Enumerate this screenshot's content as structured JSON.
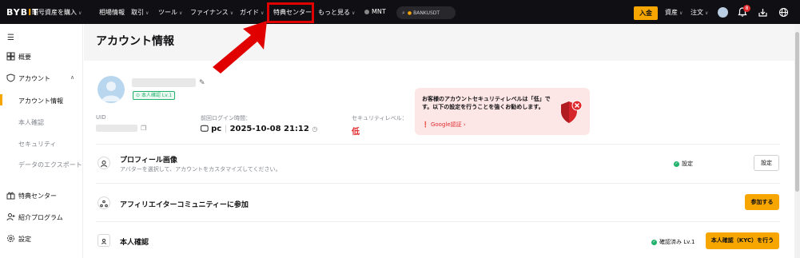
{
  "topnav": {
    "logo": "BYBIT",
    "items": [
      {
        "label": "暗号資産を購入",
        "caret": true
      },
      {
        "label": "相場情報",
        "caret": false
      },
      {
        "label": "取引",
        "caret": true
      },
      {
        "label": "ツール",
        "caret": true
      },
      {
        "label": "ファイナンス",
        "caret": true
      },
      {
        "label": "ガイド",
        "caret": true
      },
      {
        "label": "特典センター",
        "caret": false
      },
      {
        "label": "もっと見る",
        "caret": true
      },
      {
        "label": "MNT",
        "caret": false
      }
    ],
    "search_placeholder": "BANKUSDT",
    "deposit_label": "入金",
    "assets_label": "資産",
    "orders_label": "注文",
    "notification_count": "8"
  },
  "sidebar": {
    "items": [
      {
        "label": "概要",
        "icon": "overview-icon"
      },
      {
        "label": "アカウント",
        "icon": "shield-icon"
      },
      {
        "label": "特典センター",
        "icon": "gift-icon"
      },
      {
        "label": "紹介プログラム",
        "icon": "user-plus-icon"
      },
      {
        "label": "設定",
        "icon": "gear-icon"
      }
    ],
    "subitems": [
      {
        "label": "アカウント情報",
        "active": true
      },
      {
        "label": "本人確認",
        "active": false
      },
      {
        "label": "セキュリティ",
        "active": false
      },
      {
        "label": "データのエクスポート",
        "active": false
      }
    ]
  },
  "main": {
    "title": "アカウント情報",
    "verify_badge": "本人確認 Lv.1",
    "uid_label": "UID",
    "last_login_label": "前回ログイン時間：",
    "last_login_device": "pc",
    "last_login_time": "2025-10-08 21:12",
    "security_level_label": "セキュリティレベル：",
    "security_level_value": "低",
    "tooltip": {
      "message": "お客様のアカウントセキュリティレベルは「低」です。以下の設定を行うことを強くお勧めします。",
      "link": "Google認証"
    },
    "rows": [
      {
        "title": "プロフィール画像",
        "desc": "アバターを選択して、アカウントをカスタマイズしてください。",
        "status": "設定",
        "button": "設定"
      },
      {
        "title": "アフィリエイターコミュニティーに参加",
        "desc": "",
        "status": "",
        "button": "参加する"
      },
      {
        "title": "本人確認",
        "desc": "",
        "status": "確認済み Lv.1",
        "button": "本人確認（KYC）を行う"
      }
    ]
  },
  "colors": {
    "accent": "#f7a600",
    "danger": "#e0292c",
    "success": "#20b26c",
    "nav_bg": "#101014"
  }
}
